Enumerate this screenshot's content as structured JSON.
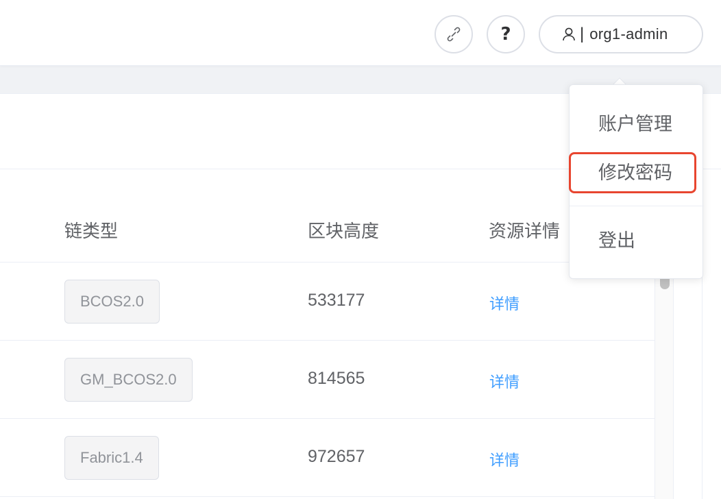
{
  "header": {
    "link_icon": "link-icon",
    "help_icon": "help-icon",
    "help_glyph": "?",
    "user_icon": "user-icon",
    "user_separator": "|",
    "username": "org1-admin"
  },
  "table": {
    "columns": [
      "链类型",
      "区块高度",
      "资源详情"
    ],
    "rows": [
      {
        "chain_type": "BCOS2.0",
        "block_height": "533177",
        "detail": "详情"
      },
      {
        "chain_type": "GM_BCOS2.0",
        "block_height": "814565",
        "detail": "详情"
      },
      {
        "chain_type": "Fabric1.4",
        "block_height": "972657",
        "detail": "详情"
      }
    ]
  },
  "dropdown": {
    "items": [
      "账户管理",
      "修改密码",
      "登出"
    ],
    "highlighted": "修改密码",
    "highlight_color": "#e8452f"
  },
  "colors": {
    "link": "#409eff",
    "text": "#606266",
    "tag_bg": "#f4f4f5"
  }
}
